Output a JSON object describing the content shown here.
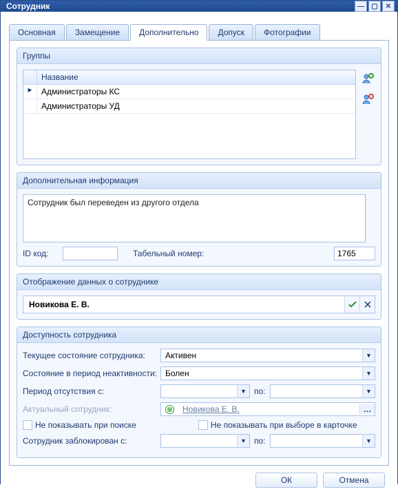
{
  "window": {
    "title": "Сотрудник"
  },
  "tabs": {
    "main": "Основная",
    "substitution": "Замещение",
    "additional": "Дополнительно",
    "access": "Допуск",
    "photos": "Фотографии"
  },
  "groups_panel": {
    "title": "Группы",
    "col_name": "Название",
    "rows": [
      "Администраторы КС",
      "Администраторы УД"
    ]
  },
  "extra_info": {
    "title": "Дополнительная информация",
    "memo": "Сотрудник был переведен из другого отдела",
    "id_label": "ID код:",
    "id_value": "",
    "tabno_label": "Табельный номер:",
    "tabno_value": "1765"
  },
  "display": {
    "title": "Отображение данных о сотруднике",
    "value": "Новикова Е. В."
  },
  "availability": {
    "title": "Доступность сотрудника",
    "current_state_label": "Текущее состояние сотрудника:",
    "current_state_value": "Активен",
    "inactive_state_label": "Состояние в период неактивности:",
    "inactive_state_value": "Болен",
    "absence_from_label": "Период отсутствия с:",
    "to_label": "по:",
    "actual_employee_label": "Актуальный сотрудник:",
    "actual_employee_value": "Новикова Е. В.",
    "hide_search_label": "Не показывать при поиске",
    "hide_card_label": "Не показывать при выборе в карточке",
    "blocked_from_label": "Сотрудник заблокирован с:"
  },
  "buttons": {
    "ok": "ОК",
    "cancel": "Отмена"
  }
}
